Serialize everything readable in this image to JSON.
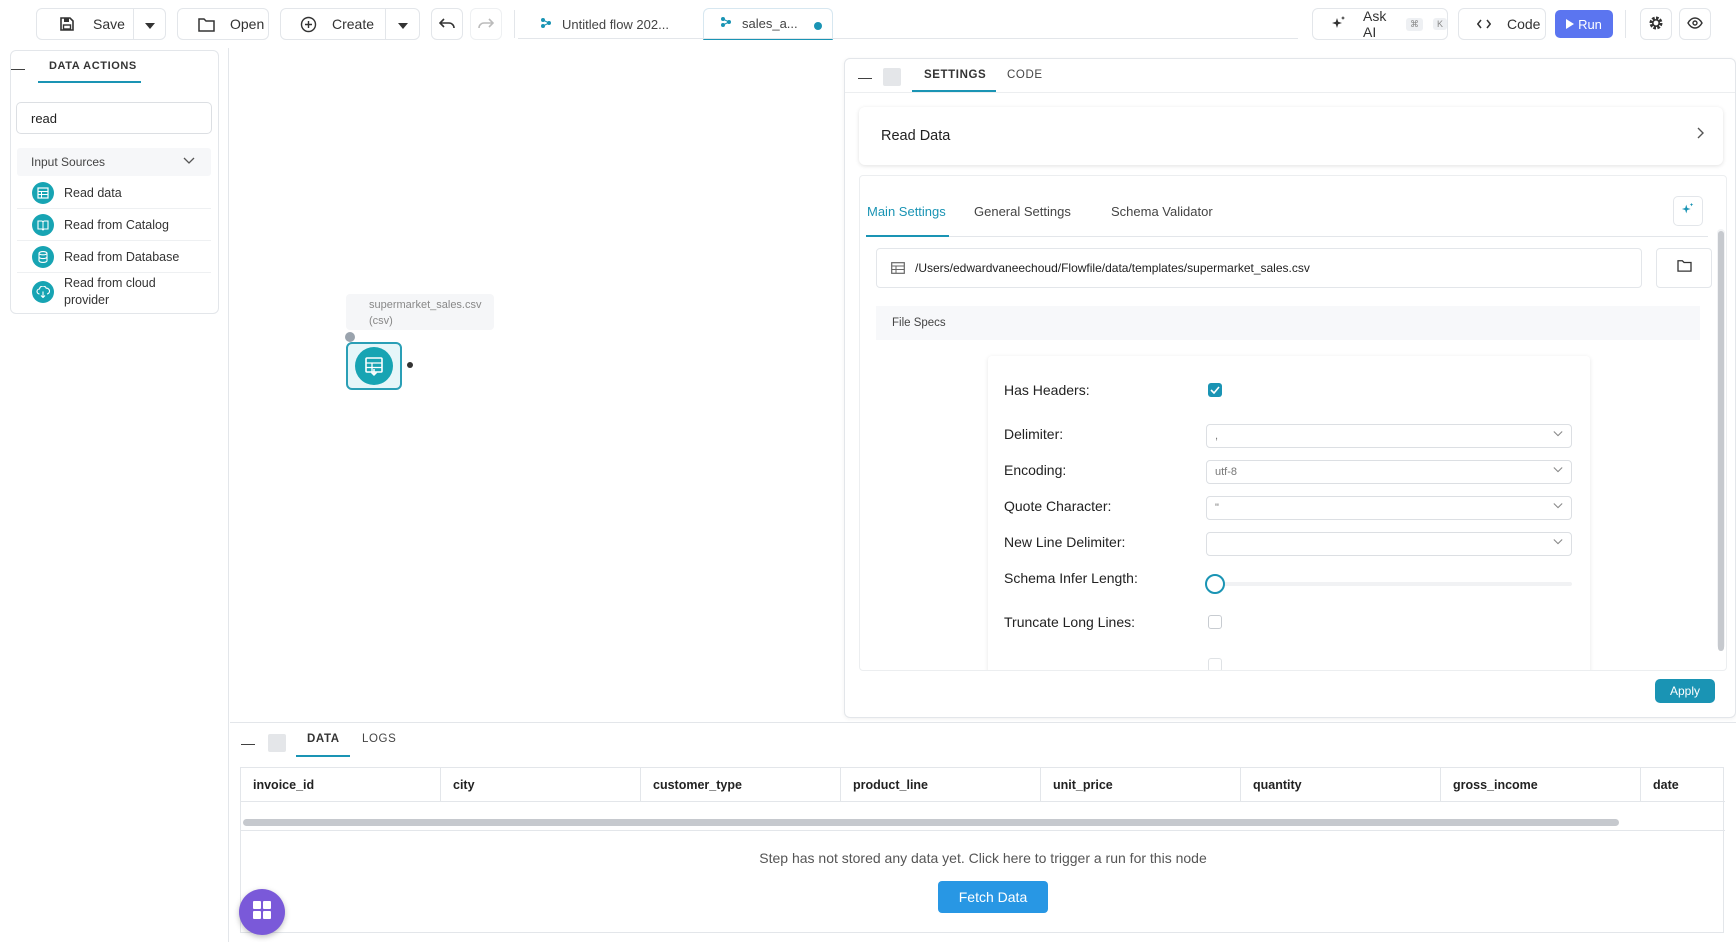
{
  "toolbar": {
    "save_label": "Save",
    "open_label": "Open",
    "create_label": "Create",
    "tabs": [
      {
        "label": "Untitled flow 202..."
      },
      {
        "label": "sales_a..."
      }
    ],
    "ask_ai_label": "Ask AI",
    "ask_ai_shortcut": [
      "⌘",
      "K"
    ],
    "code_label": "Code",
    "run_label": "Run",
    "accent_color": "#1a94b4",
    "run_color": "#5b75f0"
  },
  "left_panel": {
    "tab_label": "DATA ACTIONS",
    "search_value": "read",
    "section_label": "Input Sources",
    "items": [
      {
        "label": "Read data"
      },
      {
        "label": "Read from Catalog"
      },
      {
        "label": "Read from Database"
      },
      {
        "label": "Read from cloud provider"
      }
    ]
  },
  "canvas": {
    "node_label_line1": "supermarket_sales.csv",
    "node_label_line2": "(csv)"
  },
  "settings_panel": {
    "tabs": [
      {
        "label": "SETTINGS"
      },
      {
        "label": "CODE"
      }
    ],
    "card_title": "Read Data",
    "subtabs": [
      {
        "label": "Main Settings"
      },
      {
        "label": "General Settings"
      },
      {
        "label": "Schema Validator"
      }
    ],
    "file_path": "/Users/edwardvaneechoud/Flowfile/data/templates/supermarket_sales.csv",
    "file_specs_label": "File Specs",
    "fields": {
      "has_headers_label": "Has Headers:",
      "has_headers_checked": true,
      "delimiter_label": "Delimiter:",
      "delimiter_value": ",",
      "encoding_label": "Encoding:",
      "encoding_value": "utf-8",
      "quote_label": "Quote Character:",
      "quote_value": "\"",
      "newline_label": "New Line Delimiter:",
      "newline_value": "",
      "schema_infer_label": "Schema Infer Length:",
      "truncate_label": "Truncate Long Lines:",
      "truncate_checked": false
    },
    "apply_label": "Apply"
  },
  "data_panel": {
    "tabs": [
      {
        "label": "DATA"
      },
      {
        "label": "LOGS"
      }
    ],
    "columns": [
      "invoice_id",
      "city",
      "customer_type",
      "product_line",
      "unit_price",
      "quantity",
      "gross_income",
      "date"
    ],
    "empty_message": "Step has not stored any data yet. Click here to trigger a run for this node",
    "fetch_label": "Fetch Data"
  }
}
